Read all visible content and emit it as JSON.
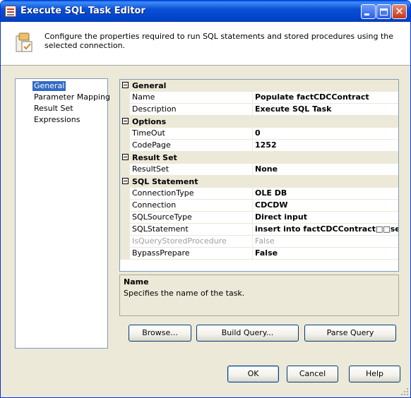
{
  "window": {
    "title": "Execute SQL Task Editor"
  },
  "header": {
    "description": "Configure the properties required to run SQL statements and stored procedures using the selected connection."
  },
  "nav": {
    "items": [
      "General",
      "Parameter Mapping",
      "Result Set",
      "Expressions"
    ],
    "selected": "General"
  },
  "properties": {
    "general": {
      "category": "General",
      "name_label": "Name",
      "name_value": "Populate factCDCContract",
      "description_label": "Description",
      "description_value": "Execute SQL Task"
    },
    "options": {
      "category": "Options",
      "timeout_label": "TimeOut",
      "timeout_value": "0",
      "codepage_label": "CodePage",
      "codepage_value": "1252"
    },
    "result_set": {
      "category": "Result Set",
      "resultset_label": "ResultSet",
      "resultset_value": "None"
    },
    "sql_statement": {
      "category": "SQL Statement",
      "connectiontype_label": "ConnectionType",
      "connectiontype_value": "OLE DB",
      "connection_label": "Connection",
      "connection_value": "CDCDW",
      "sqlsourcetype_label": "SQLSourceType",
      "sqlsourcetype_value": "Direct input",
      "sqlstatement_label": "SQLStatement",
      "sqlstatement_value": "insert into factCDCContract□□selec",
      "isquerystoredprocedure_label": "IsQueryStoredProcedure",
      "isquerystoredprocedure_value": "False",
      "bypassprepare_label": "BypassPrepare",
      "bypassprepare_value": "False"
    }
  },
  "description_panel": {
    "title": "Name",
    "text": "Specifies the name of the task."
  },
  "buttons": {
    "browse": "Browse...",
    "build_query": "Build Query...",
    "parse_query": "Parse Query",
    "ok": "OK",
    "cancel": "Cancel",
    "help": "Help"
  },
  "colors": {
    "titlebar": "#0043c8",
    "selection": "#316ac5",
    "dialog_bg": "#ece9d8"
  }
}
